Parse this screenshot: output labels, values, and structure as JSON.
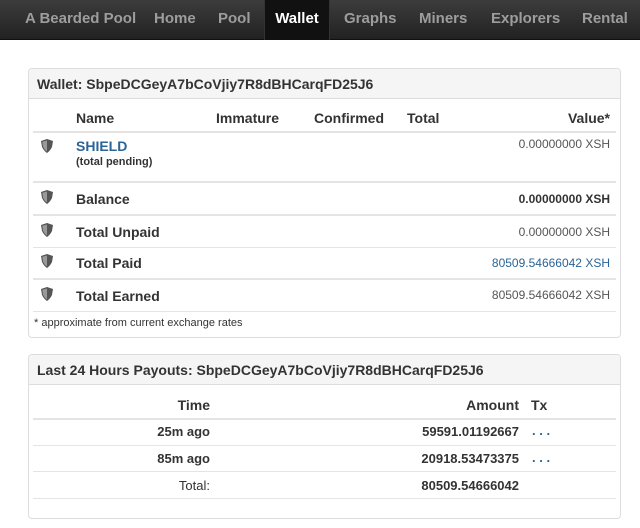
{
  "nav": {
    "brand": "A Bearded Pool",
    "items": [
      "Home",
      "Pool",
      "Wallet",
      "Graphs",
      "Miners",
      "Explorers",
      "Rental"
    ],
    "active": "Wallet"
  },
  "wallet": {
    "heading": "Wallet: SbpeDCGeyA7bCoVjiy7R8dBHCarqFD25J6",
    "columns": {
      "name": "Name",
      "immature": "Immature",
      "confirmed": "Confirmed",
      "total": "Total",
      "value": "Value*"
    },
    "coin": {
      "name": "SHIELD",
      "sub": "(total pending)",
      "value": "0.00000000 XSH"
    },
    "balance": {
      "label": "Balance",
      "value": "0.00000000 XSH"
    },
    "unpaid": {
      "label": "Total Unpaid",
      "value": "0.00000000 XSH"
    },
    "paid": {
      "label": "Total Paid",
      "value": "80509.54666042 XSH"
    },
    "earned": {
      "label": "Total Earned",
      "value": "80509.54666042 XSH"
    },
    "footnote": "* approximate from current exchange rates"
  },
  "payouts": {
    "heading": "Last 24 Hours Payouts: SbpeDCGeyA7bCoVjiy7R8dBHCarqFD25J6",
    "columns": {
      "time": "Time",
      "amount": "Amount",
      "tx": "Tx"
    },
    "rows": [
      {
        "time": "25m ago",
        "amount": "59591.01192667",
        "tx": ". . ."
      },
      {
        "time": "85m ago",
        "amount": "20918.53473375",
        "tx": ". . ."
      }
    ],
    "total": {
      "label": "Total:",
      "amount": "80509.54666042"
    }
  },
  "colors": {
    "navbar": "#222222",
    "link": "#2a6496",
    "panel_heading": "#f5f5f5"
  },
  "icons": {
    "row_icon": "shield-icon"
  }
}
